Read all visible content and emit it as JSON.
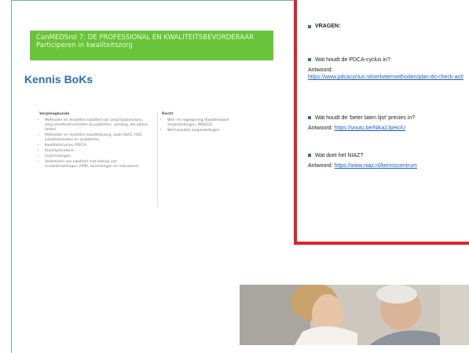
{
  "banner": {
    "line1": "CanMEDSrol 7: DE PROFESSIONAL EN KWALITEITSBEVORDERAAR",
    "line2": "Participeren in kwaliteitszorg"
  },
  "section_title": "Kennis BoKs",
  "thumbnail": {
    "left_header": "Verpleegkunde",
    "left_items": [
      "Methoden en modellen kwaliteit van zorg (taakanalyse, zorg (meetinstrumenten bij patiënten, voeding, decubitus, delier)",
      "Methoden en modellen kwaliteitszorg, zoals NIAZ, HKZ, kwaliteitsmeten en verbeteren",
      "Kwaliteitscyclus (PDCA)",
      "Klachtprocedure",
      "Cijfermetingen",
      "Verbeteren van kwaliteit met behulp van incidentmeldingen (VIM), bevindingen en indicatoren"
    ],
    "right_header": "Recht",
    "right_items": [
      "Wet- en regelgeving (Kwaliteitswet zorginstellingen, WKKGZ)",
      "Wet kwaliteit zorginstellingen"
    ]
  },
  "questions": {
    "header": "VRAGEN:",
    "items": [
      {
        "question": "Wat houdt de PDCA-cyclus in?",
        "answer_label": "Antwoord:",
        "answer_link": "https://www.pdcacyclus.nl/verbetermethoden/plan-do-check-act/"
      },
      {
        "question": "Wat houdt de ‘beter laten lijst’ precies in?",
        "answer_label": "Antwoord:",
        "answer_link": "https://youtu.be/Nika2JpHcIU"
      },
      {
        "question": "Wat doet het NIAZ?",
        "answer_label": "Antwoord:",
        "answer_link": "https://www.niaz.nl/kenniscentrum"
      }
    ]
  },
  "colors": {
    "banner": "#6ac43a",
    "title": "#2a6ebb",
    "frame": "#e0212b",
    "link": "#1a5fd0"
  }
}
